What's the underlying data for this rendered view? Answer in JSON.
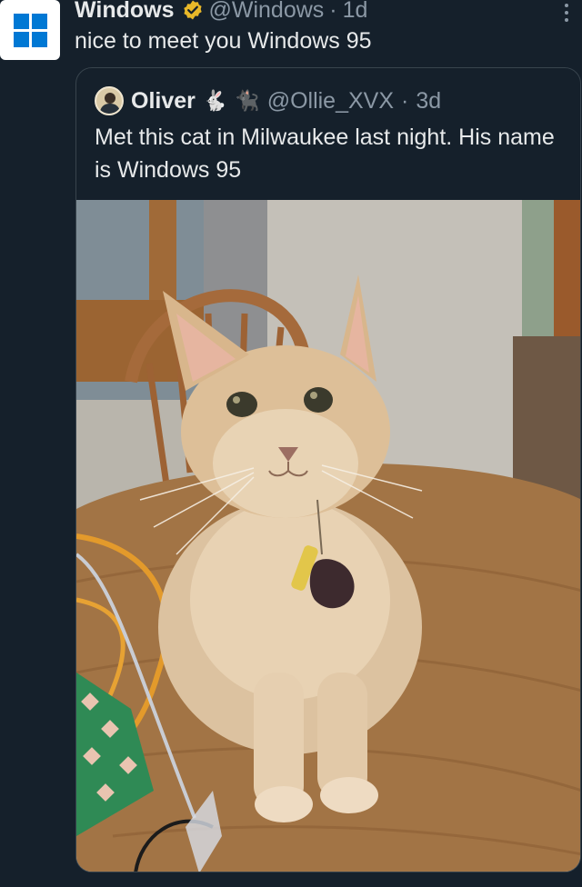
{
  "tweet": {
    "author_name": "Windows",
    "author_handle": "@Windows",
    "separator": "·",
    "time": "1d",
    "text": "nice to meet you Windows 95",
    "verified_icon": "gold-verified-badge",
    "more_icon": "vertical-ellipsis"
  },
  "quoted": {
    "author_name": "Oliver",
    "emoji_1": "🐇",
    "emoji_2": "🐈‍⬛",
    "author_handle": "@Ollie_XVX",
    "separator": "·",
    "time": "3d",
    "text": "Met this cat in Milwaukee last night. His name is Windows 95",
    "media": {
      "subject": "cream-colored cat sitting on a wooden table",
      "icon": "photo"
    }
  },
  "colors": {
    "background": "#15202b",
    "primary_text": "#e7e9ea",
    "secondary_text": "#8b98a5",
    "border": "#38444d",
    "windows_blue": "#0078d4",
    "verified_gold": "#e8b829"
  }
}
